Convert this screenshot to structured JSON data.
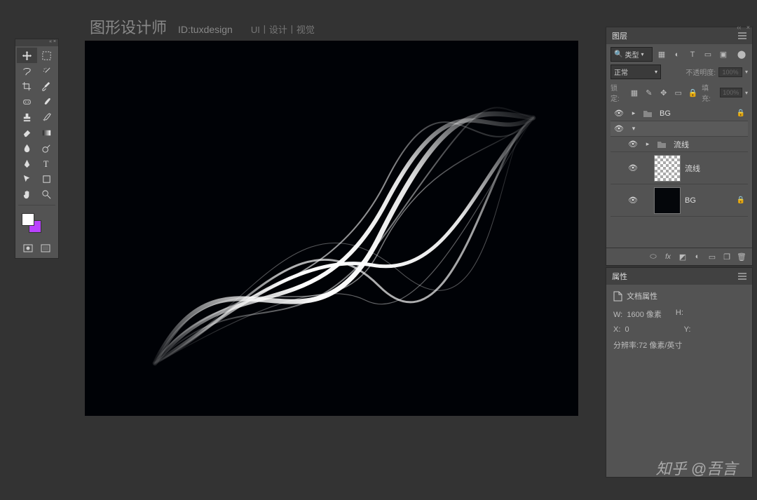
{
  "header": {
    "title": "图形设计师",
    "id": "ID:tuxdesign",
    "links": "UI丨设计丨视觉"
  },
  "toolbar": {
    "tools": [
      "move-tool",
      "marquee-tool",
      "lasso-tool",
      "magic-wand-tool",
      "crop-tool",
      "eyedropper-tool",
      "patch-tool",
      "brush-tool",
      "stamp-tool",
      "history-brush-tool",
      "eraser-tool",
      "gradient-tool",
      "blur-tool",
      "dodge-tool",
      "pen-tool",
      "type-tool",
      "path-select-tool",
      "shape-tool",
      "hand-tool",
      "zoom-tool"
    ]
  },
  "layersPanel": {
    "title": "图层",
    "filter": "类型",
    "blend": "正常",
    "opacityLabel": "不透明度:",
    "opacity": "100%",
    "lockLabel": "锁定:",
    "fillLabel": "填充:",
    "fill": "100%",
    "layers": {
      "g1": "BG",
      "l1": "流线",
      "l2": "流线",
      "l3": "BG"
    }
  },
  "propsPanel": {
    "title": "属性",
    "docprops": "文档属性",
    "wLabel": "W:",
    "wVal": "1600 像素",
    "hLabel": "H:",
    "xLabel": "X:",
    "xVal": "0",
    "yLabel": "Y:",
    "resLabel": "分辨率:",
    "resVal": "72 像素/英寸"
  },
  "watermark": "知乎 @吾言"
}
